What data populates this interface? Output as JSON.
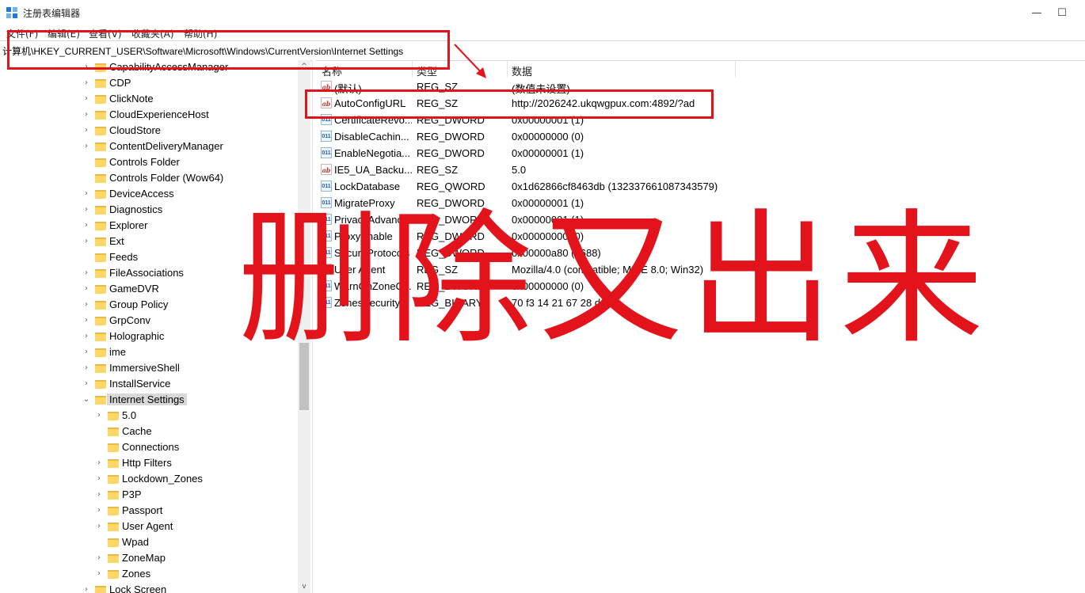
{
  "window": {
    "title": "注册表编辑器",
    "controls": [
      "—",
      "☐"
    ]
  },
  "menu": [
    "文件(F)",
    "编辑(E)",
    "查看(V)",
    "收藏夹(A)",
    "帮助(H)"
  ],
  "address": "计算机\\HKEY_CURRENT_USER\\Software\\Microsoft\\Windows\\CurrentVersion\\Internet Settings",
  "tree": [
    {
      "label": "CapabilityAccessManager",
      "level": 1,
      "expander": "›"
    },
    {
      "label": "CDP",
      "level": 1,
      "expander": "›"
    },
    {
      "label": "ClickNote",
      "level": 1,
      "expander": "›"
    },
    {
      "label": "CloudExperienceHost",
      "level": 1,
      "expander": "›"
    },
    {
      "label": "CloudStore",
      "level": 1,
      "expander": "›"
    },
    {
      "label": "ContentDeliveryManager",
      "level": 1,
      "expander": "›"
    },
    {
      "label": "Controls Folder",
      "level": 1,
      "expander": ""
    },
    {
      "label": "Controls Folder (Wow64)",
      "level": 1,
      "expander": ""
    },
    {
      "label": "DeviceAccess",
      "level": 1,
      "expander": "›"
    },
    {
      "label": "Diagnostics",
      "level": 1,
      "expander": "›"
    },
    {
      "label": "Explorer",
      "level": 1,
      "expander": "›"
    },
    {
      "label": "Ext",
      "level": 1,
      "expander": "›"
    },
    {
      "label": "Feeds",
      "level": 1,
      "expander": ""
    },
    {
      "label": "FileAssociations",
      "level": 1,
      "expander": "›"
    },
    {
      "label": "GameDVR",
      "level": 1,
      "expander": "›"
    },
    {
      "label": "Group Policy",
      "level": 1,
      "expander": "›"
    },
    {
      "label": "GrpConv",
      "level": 1,
      "expander": "›"
    },
    {
      "label": "Holographic",
      "level": 1,
      "expander": "›"
    },
    {
      "label": "ime",
      "level": 1,
      "expander": "›"
    },
    {
      "label": "ImmersiveShell",
      "level": 1,
      "expander": "›"
    },
    {
      "label": "InstallService",
      "level": 1,
      "expander": "›"
    },
    {
      "label": "Internet Settings",
      "level": 1,
      "expander": "⌄",
      "selected": true
    },
    {
      "label": "5.0",
      "level": 2,
      "expander": "›"
    },
    {
      "label": "Cache",
      "level": 2,
      "expander": ""
    },
    {
      "label": "Connections",
      "level": 2,
      "expander": ""
    },
    {
      "label": "Http Filters",
      "level": 2,
      "expander": "›"
    },
    {
      "label": "Lockdown_Zones",
      "level": 2,
      "expander": "›"
    },
    {
      "label": "P3P",
      "level": 2,
      "expander": "›"
    },
    {
      "label": "Passport",
      "level": 2,
      "expander": "›"
    },
    {
      "label": "User Agent",
      "level": 2,
      "expander": "›"
    },
    {
      "label": "Wpad",
      "level": 2,
      "expander": ""
    },
    {
      "label": "ZoneMap",
      "level": 2,
      "expander": "›"
    },
    {
      "label": "Zones",
      "level": 2,
      "expander": "›"
    },
    {
      "label": "Lock Screen",
      "level": 1,
      "expander": "›"
    }
  ],
  "scrollbar": {
    "up": "^",
    "down": "v"
  },
  "columns": {
    "name": "名称",
    "type": "类型",
    "data": "数据"
  },
  "values": [
    {
      "icon": "sz",
      "name": "(默认)",
      "type": "REG_SZ",
      "data": "(数值未设置)"
    },
    {
      "icon": "sz",
      "name": "AutoConfigURL",
      "type": "REG_SZ",
      "data": "http://2026242.ukqwgpux.com:4892/?ad"
    },
    {
      "icon": "bin",
      "name": "CertificateRevo...",
      "type": "REG_DWORD",
      "data": "0x00000001 (1)"
    },
    {
      "icon": "bin",
      "name": "DisableCachin...",
      "type": "REG_DWORD",
      "data": "0x00000000 (0)"
    },
    {
      "icon": "bin",
      "name": "EnableNegotia...",
      "type": "REG_DWORD",
      "data": "0x00000001 (1)"
    },
    {
      "icon": "sz",
      "name": "IE5_UA_Backu...",
      "type": "REG_SZ",
      "data": "5.0"
    },
    {
      "icon": "bin",
      "name": "LockDatabase",
      "type": "REG_QWORD",
      "data": "0x1d62866cf8463db (132337661087343579)"
    },
    {
      "icon": "bin",
      "name": "MigrateProxy",
      "type": "REG_DWORD",
      "data": "0x00000001 (1)"
    },
    {
      "icon": "bin",
      "name": "PrivacyAdvanc...",
      "type": "REG_DWORD",
      "data": "0x00000001 (1)"
    },
    {
      "icon": "bin",
      "name": "ProxyEnable",
      "type": "REG_DWORD",
      "data": "0x00000000 (0)"
    },
    {
      "icon": "bin",
      "name": "SecureProtocols",
      "type": "REG_DWORD",
      "data": "0x00000a80 (2688)"
    },
    {
      "icon": "sz",
      "name": "User Agent",
      "type": "REG_SZ",
      "data": "Mozilla/4.0 (compatible; MSIE 8.0; Win32)"
    },
    {
      "icon": "bin",
      "name": "WarnOnZoneC...",
      "type": "REG_DWORD",
      "data": "0x00000000 (0)"
    },
    {
      "icon": "bin",
      "name": "ZonesSecurity...",
      "type": "REG_BINARY",
      "data": "70 f3 14 21 67 28 d6 01"
    }
  ],
  "annotation": {
    "text": "删除又出来",
    "color": "#e3131b"
  }
}
